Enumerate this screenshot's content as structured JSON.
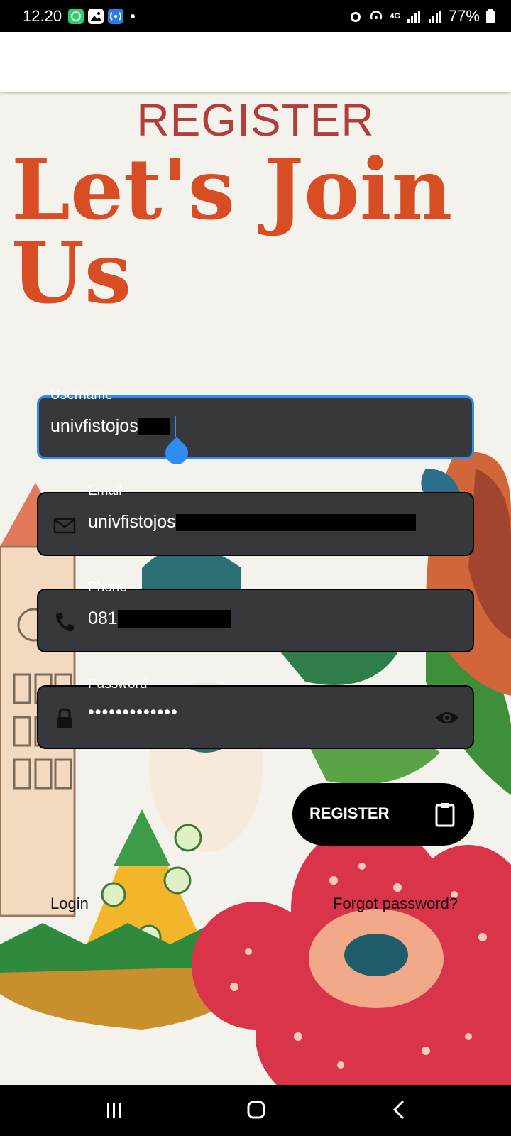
{
  "status_bar": {
    "time": "12.20",
    "network": "4G",
    "battery": "77%",
    "icons": [
      "whatsapp-icon",
      "gallery-icon",
      "hotspot-icon",
      "dot-icon",
      "alarm-icon",
      "hotspot-signal-icon",
      "signal-icon",
      "signal-icon",
      "battery-icon"
    ]
  },
  "page": {
    "title": "REGISTER",
    "hero_line1": "Let's Join",
    "hero_line2": "Us"
  },
  "form": {
    "username": {
      "label": "Username",
      "value": "univfistojos"
    },
    "email": {
      "label": "Email",
      "value": "univfistojos",
      "icon": "email-icon"
    },
    "phone": {
      "label": "Phone",
      "value": "081",
      "icon": "phone-icon"
    },
    "password": {
      "label": "Password",
      "value": "•••••••••••••",
      "icon": "lock-icon",
      "toggle_icon": "eye-icon"
    }
  },
  "actions": {
    "register_label": "REGISTER",
    "register_icon": "clipboard-icon",
    "login_label": "Login",
    "forgot_label": "Forgot password?"
  },
  "colors": {
    "title": "#b33d3a",
    "hero": "#d94d25",
    "field_bg": "#37383c",
    "focus": "#2f8cf2",
    "background": "#f4f2ec"
  },
  "nav_bar": {
    "icons": [
      "recent-apps-icon",
      "home-icon",
      "back-icon"
    ]
  }
}
